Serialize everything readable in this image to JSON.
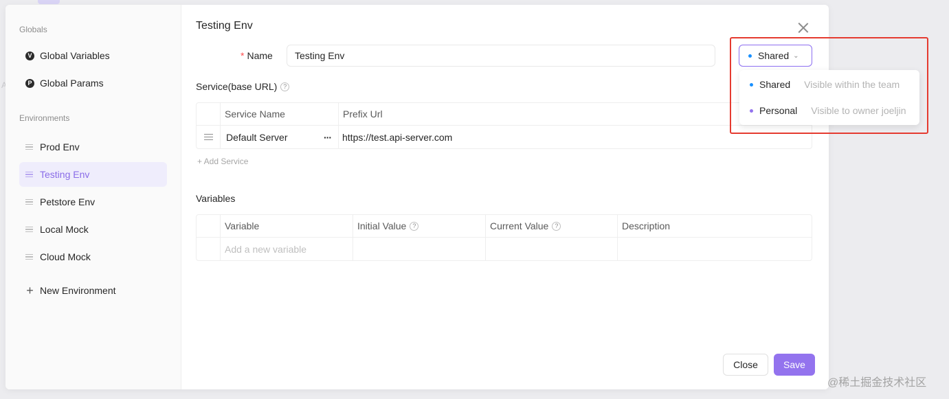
{
  "sidebar": {
    "globals_title": "Globals",
    "globals": [
      {
        "label": "Global Variables",
        "icon": "V"
      },
      {
        "label": "Global Params",
        "icon": "P"
      }
    ],
    "environments_title": "Environments",
    "environments": [
      {
        "label": "Prod Env",
        "active": false
      },
      {
        "label": "Testing Env",
        "active": true
      },
      {
        "label": "Petstore Env",
        "active": false
      },
      {
        "label": "Local Mock",
        "active": false
      },
      {
        "label": "Cloud Mock",
        "active": false
      }
    ],
    "new_env_label": "New Environment"
  },
  "main": {
    "title": "Testing Env",
    "name_label": "Name",
    "name_value": "Testing Env",
    "service_label": "Service(base URL)",
    "service_table": {
      "headers": [
        "Service Name",
        "Prefix Url"
      ],
      "rows": [
        {
          "name": "Default Server",
          "more": "···",
          "url": "https://test.api-server.com"
        }
      ]
    },
    "add_service_label": "+ Add Service",
    "variables_label": "Variables",
    "variables_table": {
      "headers": [
        "Variable",
        "Initial Value",
        "Current Value",
        "Description"
      ],
      "placeholder": "Add a new variable"
    },
    "close_label": "Close",
    "save_label": "Save"
  },
  "visibility": {
    "selected": "Shared",
    "chevron": "⌄",
    "options": [
      {
        "label": "Shared",
        "desc": "Visible within the team",
        "color": "#1890ff"
      },
      {
        "label": "Personal",
        "desc": "Visible to owner joeljin",
        "color": "#9373ee"
      }
    ]
  },
  "watermark": "@稀土掘金技术社区",
  "bg_letter": "A",
  "colors": {
    "accent": "#9373ee",
    "highlight": "#e53a2f"
  }
}
